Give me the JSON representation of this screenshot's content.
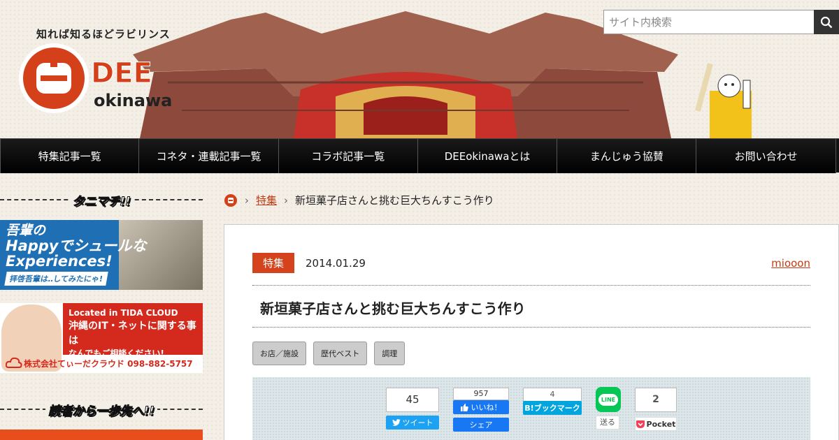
{
  "header": {
    "tagline": "知れば知るほどラビリンス",
    "logo_text": "DEE",
    "logo_sub": "okinawa",
    "search_placeholder": "サイト内検索"
  },
  "nav": [
    {
      "label": "特集記事一覧"
    },
    {
      "label": "コネタ・連載記事一覧"
    },
    {
      "label": "コラボ記事一覧"
    },
    {
      "label": "DEEokinawaとは"
    },
    {
      "label": "まんじゅう協賛"
    },
    {
      "label": "お問い合わせ"
    }
  ],
  "sidebar": {
    "heading1": "タニマチ!!",
    "banner1": {
      "line1": "吾輩の",
      "line2": "Happyでシュールな",
      "line3": "Experiences!",
      "sub": "拝啓吾輩は‥してみたにゃ!"
    },
    "banner2": {
      "line1": "Located in TIDA CLOUD",
      "line2": "沖縄のIT・ネットに関する事は",
      "line3": "なんでもご相談ください!",
      "company": "株式会社てぃーだクラウド 098-882-5757"
    },
    "heading2": "読者から一歩先へ!!"
  },
  "breadcrumb": {
    "category": "特集",
    "current": "新垣菓子店さんと挑む巨大ちんすこう作り"
  },
  "article": {
    "category": "特集",
    "date": "2014.01.29",
    "author": "miooon",
    "title": "新垣菓子店さんと挑む巨大ちんすこう作り",
    "tags": [
      "お店／施設",
      "歴代ベスト",
      "調理"
    ]
  },
  "share": {
    "twitter": {
      "count": "45",
      "label": "ツイート"
    },
    "facebook": {
      "count": "957",
      "like": "いいね！",
      "share": "シェア"
    },
    "hatena": {
      "count": "4",
      "label": "B!ブックマーク"
    },
    "line": {
      "icon": "LINE",
      "label": "送る"
    },
    "pocket": {
      "count": "2",
      "label": "Pocket"
    }
  },
  "colors": {
    "accent": "#d5431c",
    "nav_bg": "#111111",
    "twitter": "#1da1f2",
    "facebook": "#1877f2",
    "hatena": "#00a4de",
    "line": "#06c755",
    "pocket": "#ef4056"
  }
}
